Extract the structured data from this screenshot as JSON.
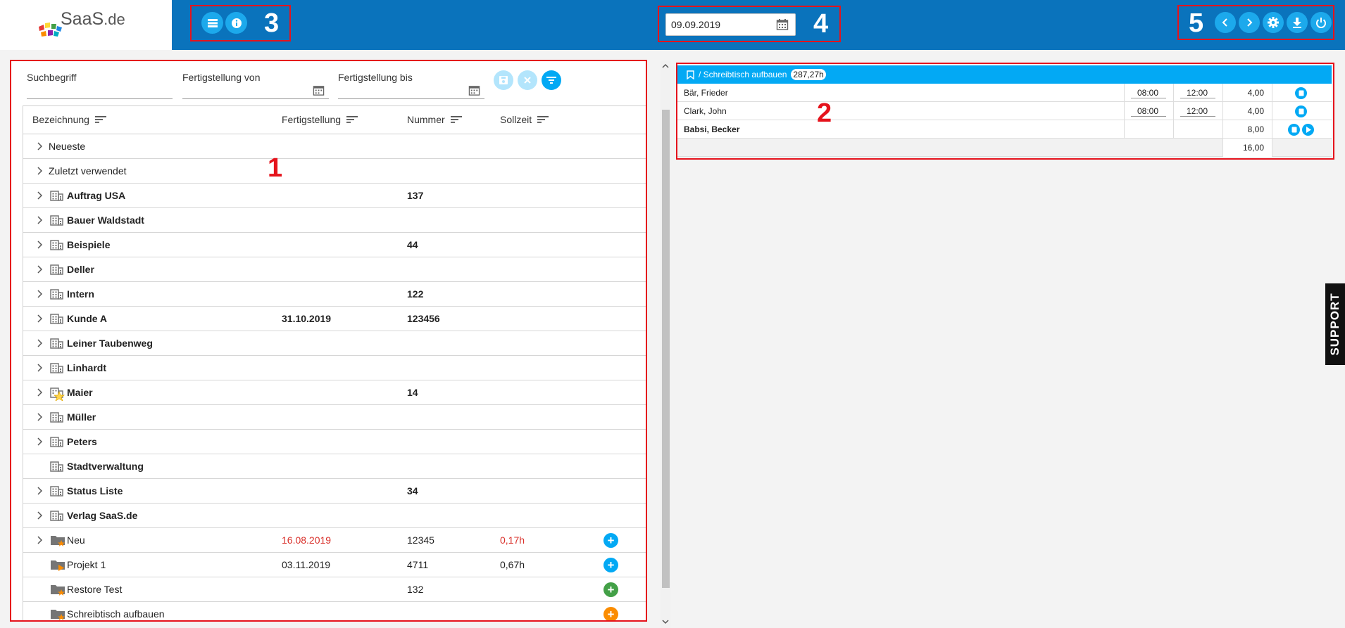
{
  "header": {
    "logo": "SaaS.de",
    "logo_main": "SaaS",
    "logo_suffix": ".de",
    "date_value": "09.09.2019",
    "icons": [
      "list-icon",
      "info-icon",
      "chevron-left-icon",
      "chevron-right-icon",
      "gear-icon",
      "download-icon",
      "power-icon"
    ]
  },
  "annotations": {
    "n1": "1",
    "n2": "2",
    "n3": "3",
    "n4": "4",
    "n5": "5"
  },
  "filters": {
    "search_label": "Suchbegriff",
    "from_label": "Fertigstellung von",
    "to_label": "Fertigstellung bis"
  },
  "grid": {
    "columns": [
      "Bezeichnung",
      "Fertigstellung",
      "Nummer",
      "Sollzeit"
    ],
    "rows": [
      {
        "label": "Neueste",
        "date": "",
        "number": "",
        "soll": "",
        "bold": false,
        "icon": "none",
        "chevron": true
      },
      {
        "label": "Zuletzt verwendet",
        "date": "",
        "number": "",
        "soll": "",
        "bold": false,
        "icon": "none",
        "chevron": true
      },
      {
        "label": "Auftrag USA",
        "date": "",
        "number": "137",
        "soll": "",
        "bold": true,
        "icon": "building",
        "chevron": true
      },
      {
        "label": "Bauer Waldstadt",
        "date": "",
        "number": "",
        "soll": "",
        "bold": true,
        "icon": "building",
        "chevron": true
      },
      {
        "label": "Beispiele",
        "date": "",
        "number": "44",
        "soll": "",
        "bold": true,
        "icon": "building",
        "chevron": true
      },
      {
        "label": "Deller",
        "date": "",
        "number": "",
        "soll": "",
        "bold": true,
        "icon": "building",
        "chevron": true
      },
      {
        "label": "Intern",
        "date": "",
        "number": "122",
        "soll": "",
        "bold": true,
        "icon": "building",
        "chevron": true
      },
      {
        "label": "Kunde A",
        "date": "31.10.2019",
        "number": "123456",
        "soll": "",
        "bold": true,
        "icon": "building",
        "chevron": true
      },
      {
        "label": "Leiner Taubenweg",
        "date": "",
        "number": "",
        "soll": "",
        "bold": true,
        "icon": "building",
        "chevron": true
      },
      {
        "label": "Linhardt",
        "date": "",
        "number": "",
        "soll": "",
        "bold": true,
        "icon": "building",
        "chevron": true
      },
      {
        "label": "Maier",
        "date": "",
        "number": "14",
        "soll": "",
        "bold": true,
        "icon": "building-star",
        "chevron": true
      },
      {
        "label": "Müller",
        "date": "",
        "number": "",
        "soll": "",
        "bold": true,
        "icon": "building",
        "chevron": true
      },
      {
        "label": "Peters",
        "date": "",
        "number": "",
        "soll": "",
        "bold": true,
        "icon": "building",
        "chevron": true
      },
      {
        "label": "Stadtverwaltung",
        "date": "",
        "number": "",
        "soll": "",
        "bold": true,
        "icon": "building",
        "chevron": false
      },
      {
        "label": "Status Liste",
        "date": "",
        "number": "34",
        "soll": "",
        "bold": true,
        "icon": "building",
        "chevron": true
      },
      {
        "label": "Verlag SaaS.de",
        "date": "",
        "number": "",
        "soll": "",
        "bold": true,
        "icon": "building",
        "chevron": true
      },
      {
        "label": "Neu",
        "date": "16.08.2019",
        "number": "12345",
        "soll": "0,17h",
        "bold": false,
        "icon": "folder-star",
        "chevron": true,
        "red": true,
        "plus": "#03a9f4"
      },
      {
        "label": "Projekt 1",
        "date": "03.11.2019",
        "number": "4711",
        "soll": "0,67h",
        "bold": false,
        "icon": "folder-play",
        "chevron": false,
        "plus": "#03a9f4"
      },
      {
        "label": "Restore Test",
        "date": "",
        "number": "132",
        "soll": "",
        "bold": false,
        "icon": "folder-star",
        "chevron": false,
        "plus": "#43a047"
      },
      {
        "label": "Schreibtisch aufbauen",
        "date": "",
        "number": "",
        "soll": "",
        "bold": false,
        "icon": "folder-star",
        "chevron": false,
        "plus": "#fb8c00"
      }
    ]
  },
  "task": {
    "title": "/ Schreibtisch aufbauen",
    "hours": "287,27h",
    "rows": [
      {
        "name": "Bär, Frieder",
        "start": "08:00",
        "end": "12:00",
        "value": "4,00",
        "bold": false
      },
      {
        "name": "Clark, John",
        "start": "08:00",
        "end": "12:00",
        "value": "4,00",
        "bold": false
      },
      {
        "name": "Babsi, Becker",
        "start": "",
        "end": "",
        "value": "8,00",
        "bold": true
      }
    ],
    "total": "16,00"
  },
  "support_label": "SUPPORT",
  "colors": {
    "header": "#0a73bc",
    "accent": "#03a9f4",
    "annotation_red": "#e5131c",
    "overdue_red": "#d9302a"
  }
}
